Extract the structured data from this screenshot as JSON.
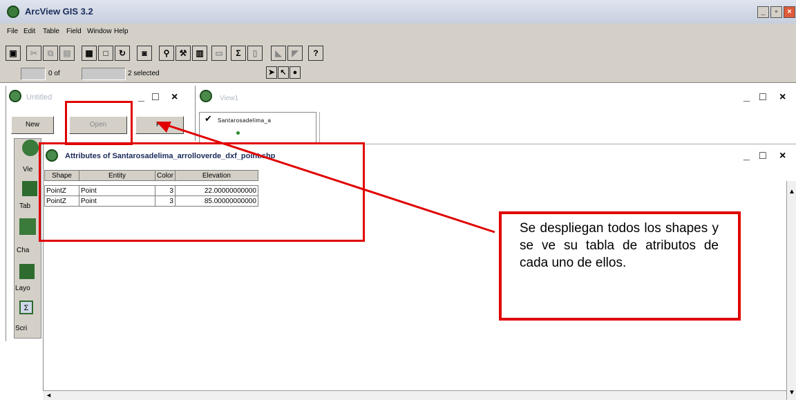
{
  "app": {
    "title": "ArcView GIS 3.2"
  },
  "menu": [
    "File",
    "Edit",
    "Table",
    "Field",
    "Window",
    "Help"
  ],
  "status": {
    "count": "0 of",
    "selected": "2 selected"
  },
  "project": {
    "title": "Untitled",
    "buttons": {
      "new": "New",
      "open": "Open",
      "print": "Pr"
    },
    "docs": [
      "Views",
      "Tables",
      "Charts",
      "Layouts",
      "Scripts"
    ],
    "docs_visible": [
      "Vie",
      "Tab",
      "Cha",
      "Layo",
      "Scri"
    ]
  },
  "view": {
    "title": "View1",
    "layer": "Santarosadelima_a"
  },
  "attributes": {
    "title": "Attributes of Santarosadelima_arrolloverde_dxf_point.shp",
    "columns": [
      "Shape",
      "Entity",
      "Color",
      "Elevation"
    ],
    "rows": [
      [
        "PointZ",
        "Point",
        "3",
        "22.00000000000"
      ],
      [
        "PointZ",
        "Point",
        "3",
        "85.00000000000"
      ]
    ]
  },
  "callout": {
    "text": "Se despliegan todos los shapes y se ve su tabla de atributos de cada uno de ellos."
  },
  "colors": {
    "annotation": "#e00000",
    "titlebar": "#c7cfde"
  }
}
